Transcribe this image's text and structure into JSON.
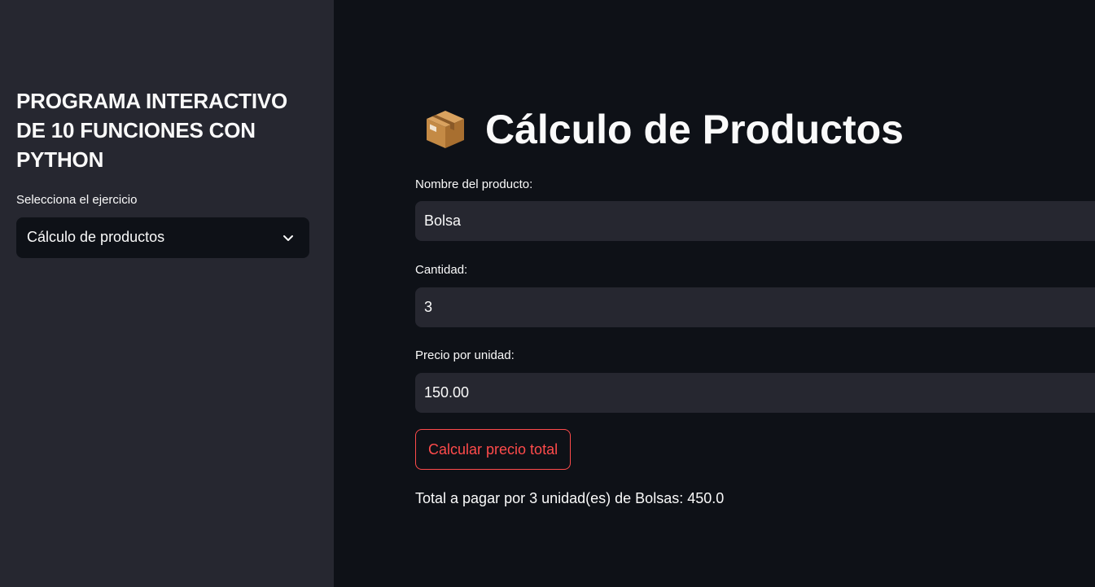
{
  "sidebar": {
    "title": "PROGRAMA INTERACTIVO DE 10 FUNCIONES CON PYTHON",
    "select_label": "Selecciona el ejercicio",
    "select_value": "Cálculo de productos",
    "select_icon": "chevron-down-icon"
  },
  "main": {
    "title_icon": "package-icon",
    "title": "Cálculo de Productos",
    "fields": [
      {
        "label": "Nombre del producto:",
        "value": "Bolsa"
      },
      {
        "label": "Cantidad:",
        "value": "3"
      },
      {
        "label": "Precio por unidad:",
        "value": "150.00"
      }
    ],
    "button_label": "Calcular precio total",
    "result_text": "Total a pagar por 3 unidad(es) de Bolsas: 450.0"
  },
  "colors": {
    "background": "#0e1117",
    "sidebar_background": "#262730",
    "input_background": "#262730",
    "accent": "#ff4b4b",
    "text": "#fafafa"
  }
}
